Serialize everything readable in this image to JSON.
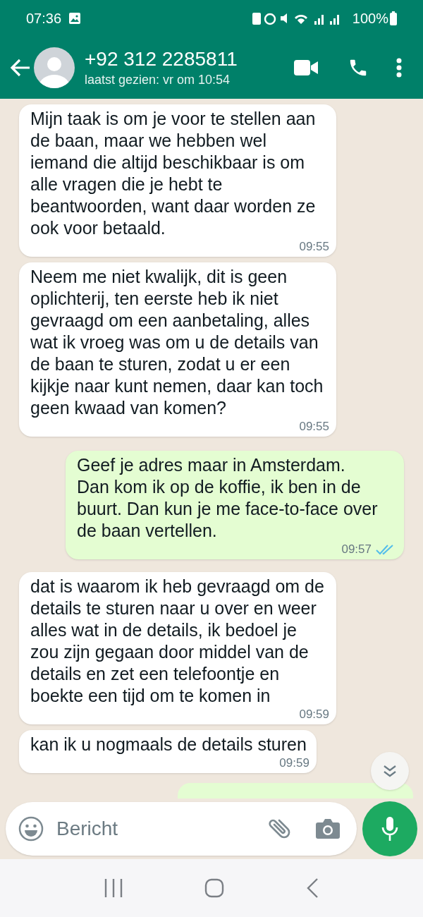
{
  "status_bar": {
    "time": "07:36",
    "battery": "100%"
  },
  "header": {
    "contact": "+92 312 2285811",
    "last_seen": "laatst gezien: vr om 10:54"
  },
  "messages": [
    {
      "kind": "incoming",
      "text": "Mijn taak is om je voor te stellen aan de baan, maar we hebben wel iemand die altijd beschikbaar is om alle vragen die je hebt te beantwoorden, want daar worden ze ook voor betaald.",
      "time": "09:55"
    },
    {
      "kind": "incoming",
      "text": "Neem me niet kwalijk, dit is geen oplichterij, ten eerste heb ik niet gevraagd om een aanbetaling, alles wat ik vroeg was om u de details van de baan te sturen, zodat u er een kijkje naar kunt nemen, daar kan toch geen kwaad van komen?",
      "time": "09:55"
    },
    {
      "kind": "outgoing",
      "text": "Geef je adres maar in Amsterdam. Dan kom ik op de koffie, ik ben in de buurt. Dan kun je me face-to-face over de baan vertellen.",
      "time": "09:57",
      "read": true
    },
    {
      "kind": "incoming",
      "text": "dat is waarom ik heb gevraagd om de details te sturen naar u over en weer alles wat in de details, ik bedoel je zou zijn gegaan door middel van de details en zet een telefoontje en boekte een tijd om te komen in",
      "time": "09:59"
    },
    {
      "kind": "incoming",
      "text": "kan ik u nogmaals de details sturen",
      "time": "09:59"
    },
    {
      "kind": "outgoing_partial"
    }
  ],
  "composer": {
    "placeholder": "Bericht"
  }
}
